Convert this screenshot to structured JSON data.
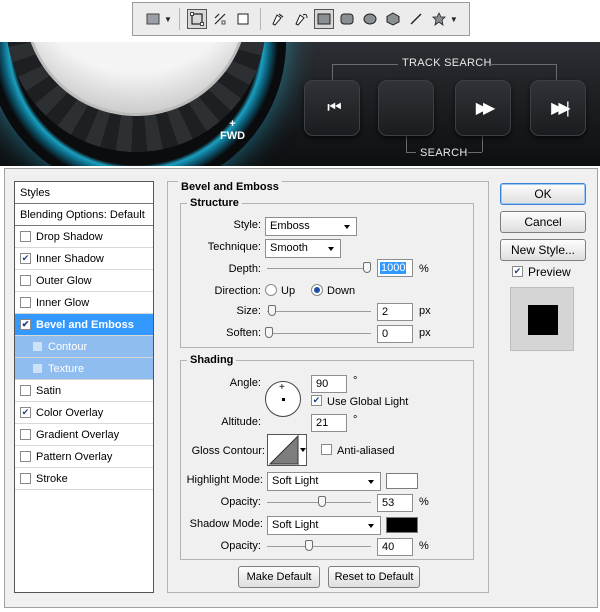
{
  "toolbar": {
    "icons": [
      "rectangle-tool-icon",
      "shape-layers-icon",
      "paths-icon",
      "fill-pixels-icon",
      "pen-icon",
      "freeform-pen-icon",
      "rectangle-shape-icon",
      "rounded-rectangle-icon",
      "ellipse-icon",
      "polygon-icon",
      "line-icon",
      "custom-shape-icon"
    ]
  },
  "banner": {
    "fwd_plus": "+",
    "fwd_label": "FWD",
    "track_search": "TRACK SEARCH",
    "search": "SEARCH",
    "buttons": [
      "prev-track",
      "empty",
      "fast-forward",
      "next-track"
    ],
    "glyphs": {
      "prev": "⏮",
      "ff": "▶▶",
      "next": "▶▶|"
    }
  },
  "styles_panel": {
    "header": "Styles",
    "blending": "Blending Options: Default",
    "items": [
      {
        "label": "Drop Shadow",
        "checked": false
      },
      {
        "label": "Inner Shadow",
        "checked": true
      },
      {
        "label": "Outer Glow",
        "checked": false
      },
      {
        "label": "Inner Glow",
        "checked": false
      },
      {
        "label": "Bevel and Emboss",
        "checked": true,
        "selected": true
      },
      {
        "label": "Contour",
        "checked": false,
        "sub": true
      },
      {
        "label": "Texture",
        "checked": false,
        "sub": true
      },
      {
        "label": "Satin",
        "checked": false
      },
      {
        "label": "Color Overlay",
        "checked": true
      },
      {
        "label": "Gradient Overlay",
        "checked": false
      },
      {
        "label": "Pattern Overlay",
        "checked": false
      },
      {
        "label": "Stroke",
        "checked": false
      }
    ]
  },
  "bevel": {
    "title": "Bevel and Emboss",
    "structure_title": "Structure",
    "style_label": "Style:",
    "style_value": "Emboss",
    "technique_label": "Technique:",
    "technique_value": "Smooth",
    "depth_label": "Depth:",
    "depth_value": "1000",
    "depth_unit": "%",
    "depth_level": 1.0,
    "direction_label": "Direction:",
    "up_label": "Up",
    "down_label": "Down",
    "direction_selected": "Down",
    "size_label": "Size:",
    "size_value": "2",
    "size_unit": "px",
    "soften_label": "Soften:",
    "soften_value": "0",
    "soften_unit": "px",
    "shading_title": "Shading",
    "angle_label": "Angle:",
    "angle_value": "90",
    "angle_unit": "°",
    "use_global_light": "Use Global Light",
    "use_global_light_checked": true,
    "altitude_label": "Altitude:",
    "altitude_value": "21",
    "altitude_unit": "°",
    "gloss_label": "Gloss Contour:",
    "anti_aliased": "Anti-aliased",
    "anti_aliased_checked": false,
    "highlight_mode_label": "Highlight Mode:",
    "highlight_mode_value": "Soft Light",
    "highlight_color": "#ffffff",
    "highlight_opacity_label": "Opacity:",
    "highlight_opacity_value": "53",
    "highlight_opacity_unit": "%",
    "shadow_mode_label": "Shadow Mode:",
    "shadow_mode_value": "Soft Light",
    "shadow_color": "#000000",
    "shadow_opacity_label": "Opacity:",
    "shadow_opacity_value": "40",
    "shadow_opacity_unit": "%",
    "make_default": "Make Default",
    "reset_default": "Reset to Default"
  },
  "actions": {
    "ok": "OK",
    "cancel": "Cancel",
    "new_style": "New Style...",
    "preview": "Preview",
    "preview_checked": true
  }
}
